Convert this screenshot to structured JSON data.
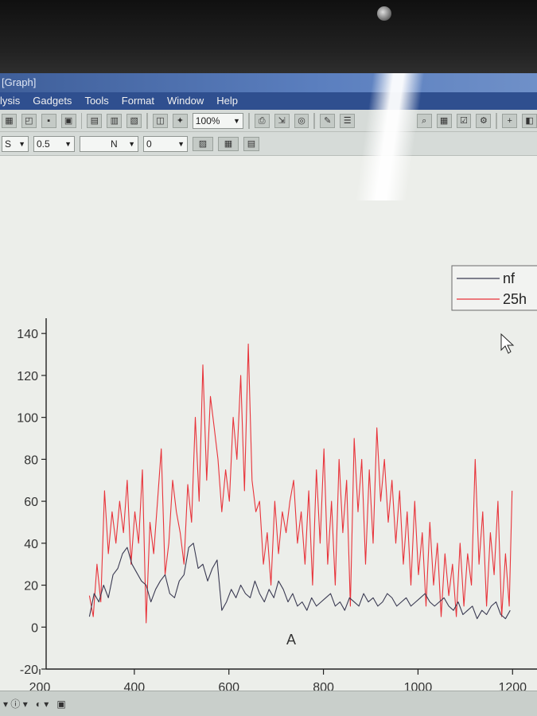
{
  "window": {
    "title": "[Graph]"
  },
  "menu": {
    "items": [
      "lysis",
      "Gadgets",
      "Tools",
      "Format",
      "Window",
      "Help"
    ]
  },
  "toolbar": {
    "zoom": "100%"
  },
  "format_toolbar": {
    "line_style": "S",
    "line_width": "0.5",
    "fill_label": "N",
    "pattern_value": "0"
  },
  "colors": {
    "nf": "#3a3a52",
    "25h": "#e8333a",
    "axis": "#222222"
  },
  "chart_data": {
    "type": "line",
    "title": "",
    "xlabel": "A",
    "ylabel": "",
    "xlim": [
      200,
      1250
    ],
    "ylim": [
      -20,
      145
    ],
    "xticks": [
      200,
      400,
      600,
      800,
      1000,
      1200
    ],
    "yticks": [
      -20,
      0,
      20,
      40,
      60,
      80,
      100,
      120,
      140
    ],
    "grid": false,
    "legend_position": "top-right",
    "series": [
      {
        "name": "nf",
        "color": "#3a3a52",
        "x": [
          305,
          315,
          325,
          335,
          345,
          355,
          365,
          375,
          385,
          395,
          405,
          415,
          425,
          435,
          445,
          455,
          465,
          475,
          485,
          495,
          505,
          515,
          525,
          535,
          545,
          555,
          565,
          575,
          585,
          595,
          605,
          615,
          625,
          635,
          645,
          655,
          665,
          675,
          685,
          695,
          705,
          715,
          725,
          735,
          745,
          755,
          765,
          775,
          785,
          795,
          805,
          815,
          825,
          835,
          845,
          855,
          865,
          875,
          885,
          895,
          905,
          915,
          925,
          935,
          945,
          955,
          965,
          975,
          985,
          995,
          1005,
          1015,
          1025,
          1035,
          1045,
          1055,
          1065,
          1075,
          1085,
          1095,
          1105,
          1115,
          1125,
          1135,
          1145,
          1155,
          1165,
          1175,
          1185,
          1195
        ],
        "values": [
          5,
          16,
          12,
          20,
          14,
          25,
          28,
          35,
          38,
          30,
          26,
          22,
          20,
          12,
          18,
          22,
          25,
          16,
          14,
          22,
          25,
          38,
          40,
          28,
          30,
          22,
          28,
          32,
          8,
          12,
          18,
          14,
          20,
          16,
          14,
          22,
          16,
          12,
          18,
          14,
          22,
          18,
          12,
          16,
          10,
          12,
          8,
          14,
          10,
          12,
          14,
          16,
          10,
          12,
          8,
          14,
          12,
          10,
          16,
          12,
          14,
          10,
          12,
          16,
          14,
          10,
          12,
          14,
          10,
          12,
          14,
          16,
          12,
          10,
          12,
          14,
          10,
          8,
          12,
          6,
          8,
          10,
          4,
          8,
          6,
          10,
          12,
          6,
          4,
          8
        ]
      },
      {
        "name": "25h",
        "color": "#e8333a",
        "x": [
          305,
          313,
          321,
          329,
          337,
          345,
          353,
          361,
          369,
          377,
          385,
          393,
          401,
          409,
          417,
          425,
          433,
          441,
          449,
          457,
          465,
          473,
          481,
          489,
          497,
          505,
          513,
          521,
          529,
          537,
          545,
          553,
          561,
          569,
          577,
          585,
          593,
          601,
          609,
          617,
          625,
          633,
          641,
          649,
          657,
          665,
          673,
          681,
          689,
          697,
          705,
          713,
          721,
          729,
          737,
          745,
          753,
          761,
          769,
          777,
          785,
          793,
          801,
          809,
          817,
          825,
          833,
          841,
          849,
          857,
          865,
          873,
          881,
          889,
          897,
          905,
          913,
          921,
          929,
          937,
          945,
          953,
          961,
          969,
          977,
          985,
          993,
          1001,
          1009,
          1017,
          1025,
          1033,
          1041,
          1049,
          1057,
          1065,
          1073,
          1081,
          1089,
          1097,
          1105,
          1113,
          1121,
          1129,
          1137,
          1145,
          1153,
          1161,
          1169,
          1177,
          1185,
          1193,
          1199
        ],
        "values": [
          15,
          5,
          30,
          12,
          65,
          35,
          55,
          40,
          60,
          45,
          70,
          30,
          55,
          40,
          75,
          2,
          50,
          35,
          60,
          85,
          25,
          40,
          70,
          55,
          45,
          30,
          68,
          50,
          100,
          60,
          125,
          70,
          110,
          95,
          80,
          55,
          75,
          60,
          100,
          80,
          120,
          65,
          135,
          70,
          55,
          60,
          30,
          45,
          20,
          60,
          35,
          55,
          45,
          60,
          70,
          40,
          55,
          30,
          65,
          20,
          75,
          40,
          85,
          30,
          60,
          20,
          80,
          45,
          70,
          10,
          90,
          55,
          80,
          30,
          75,
          40,
          95,
          60,
          80,
          50,
          70,
          40,
          65,
          30,
          55,
          20,
          60,
          25,
          45,
          10,
          50,
          20,
          40,
          5,
          35,
          15,
          30,
          5,
          40,
          10,
          35,
          20,
          80,
          30,
          55,
          10,
          45,
          25,
          60,
          5,
          35,
          10,
          65
        ]
      }
    ]
  }
}
